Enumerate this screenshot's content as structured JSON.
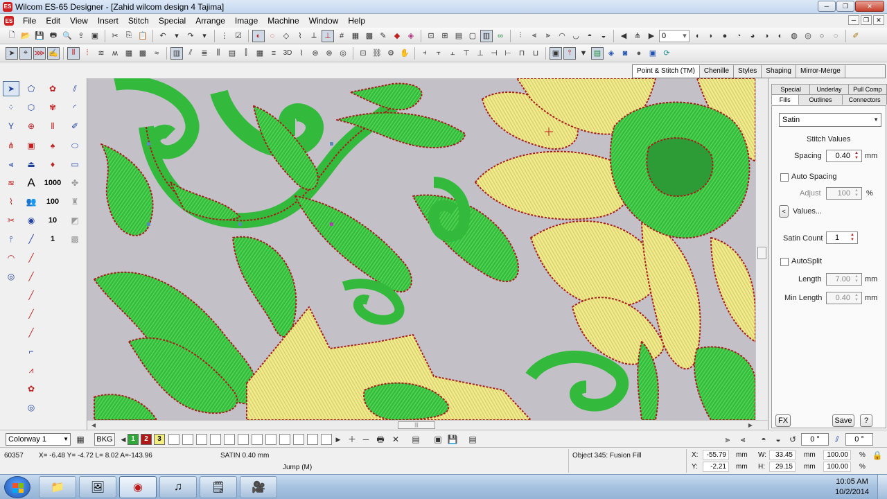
{
  "window": {
    "title": "Wilcom ES-65 Designer - [Zahid wilcom design 4        Tajima]",
    "logo_text": "ES",
    "min_glyph": "─",
    "max_glyph": "❐",
    "close_glyph": "✕"
  },
  "menu": {
    "items": [
      "File",
      "Edit",
      "View",
      "Insert",
      "Stitch",
      "Special",
      "Arrange",
      "Image",
      "Machine",
      "Window",
      "Help"
    ],
    "mdi_min": "─",
    "mdi_restore": "❐",
    "mdi_close": "✕"
  },
  "toolbar": {
    "angle_value": "0"
  },
  "stitch_tabs": [
    "Point & Stitch (TM)",
    "Chenille",
    "Styles",
    "Shaping",
    "Mirror-Merge"
  ],
  "toolbox": {
    "numbers": [
      "1000",
      "100",
      "10",
      "1",
      "1000",
      "100"
    ],
    "text_tool_glyph": "A"
  },
  "docker": {
    "tabs_row1": [
      "Special",
      "Underlay",
      "Pull Comp"
    ],
    "tabs_row2": [
      "Fills",
      "Outlines",
      "Connectors"
    ],
    "fill_type": "Satin",
    "section_title": "Stitch Values",
    "spacing_label": "Spacing",
    "spacing_value": "0.40",
    "spacing_unit": "mm",
    "auto_spacing_label": "Auto Spacing",
    "adjust_label": "Adjust",
    "adjust_value": "100",
    "adjust_unit": "%",
    "values_button": "Values...",
    "satin_count_label": "Satin Count",
    "satin_count_value": "1",
    "autosplit_label": "AutoSplit",
    "length_label": "Length",
    "length_value": "7.00",
    "length_unit": "mm",
    "min_length_label": "Min Length",
    "min_length_value": "0.40",
    "min_length_unit": "mm",
    "fx_button": "FX",
    "save_button": "Save",
    "help_button": "?"
  },
  "colorbar": {
    "colorway": "Colorway 1",
    "bkg_label": "BKG",
    "swatches": [
      {
        "label": "1",
        "color": "#2ea836"
      },
      {
        "label": "2",
        "color": "#b01818"
      },
      {
        "label": "3",
        "color": "#f4ee80"
      }
    ],
    "spin1_value": "0",
    "spin2_value": "0",
    "degree_symbol": "°"
  },
  "status": {
    "stitch_count": "60357",
    "coords": "X=  -6.48 Y=  -4.72 L=     8.02 A=-143.96",
    "stitch_type": "SATIN  0.40 mm",
    "jump": "Jump (M)",
    "object": "Object 345: Fusion Fill",
    "x_label": "X:",
    "x_value": "-55.79",
    "y_label": "Y:",
    "y_value": "-2.21",
    "w_label": "W:",
    "w_value": "33.45",
    "h_label": "H:",
    "h_value": "29.15",
    "unit_mm": "mm",
    "pct1_value": "100.00",
    "pct2_value": "100.00",
    "unit_pct": "%"
  },
  "taskbar": {
    "time": "10:05 AM",
    "date": "10/2/2014",
    "apps": [
      "explorer",
      "paint",
      "embroidery",
      "music",
      "notes",
      "media"
    ]
  },
  "colors": {
    "green": "#2fb83a",
    "green_light": "#4fd04f",
    "yellow": "#f2ec94",
    "stitch_red": "#a61e1e",
    "canvas_bg": "#c3c0c8"
  }
}
